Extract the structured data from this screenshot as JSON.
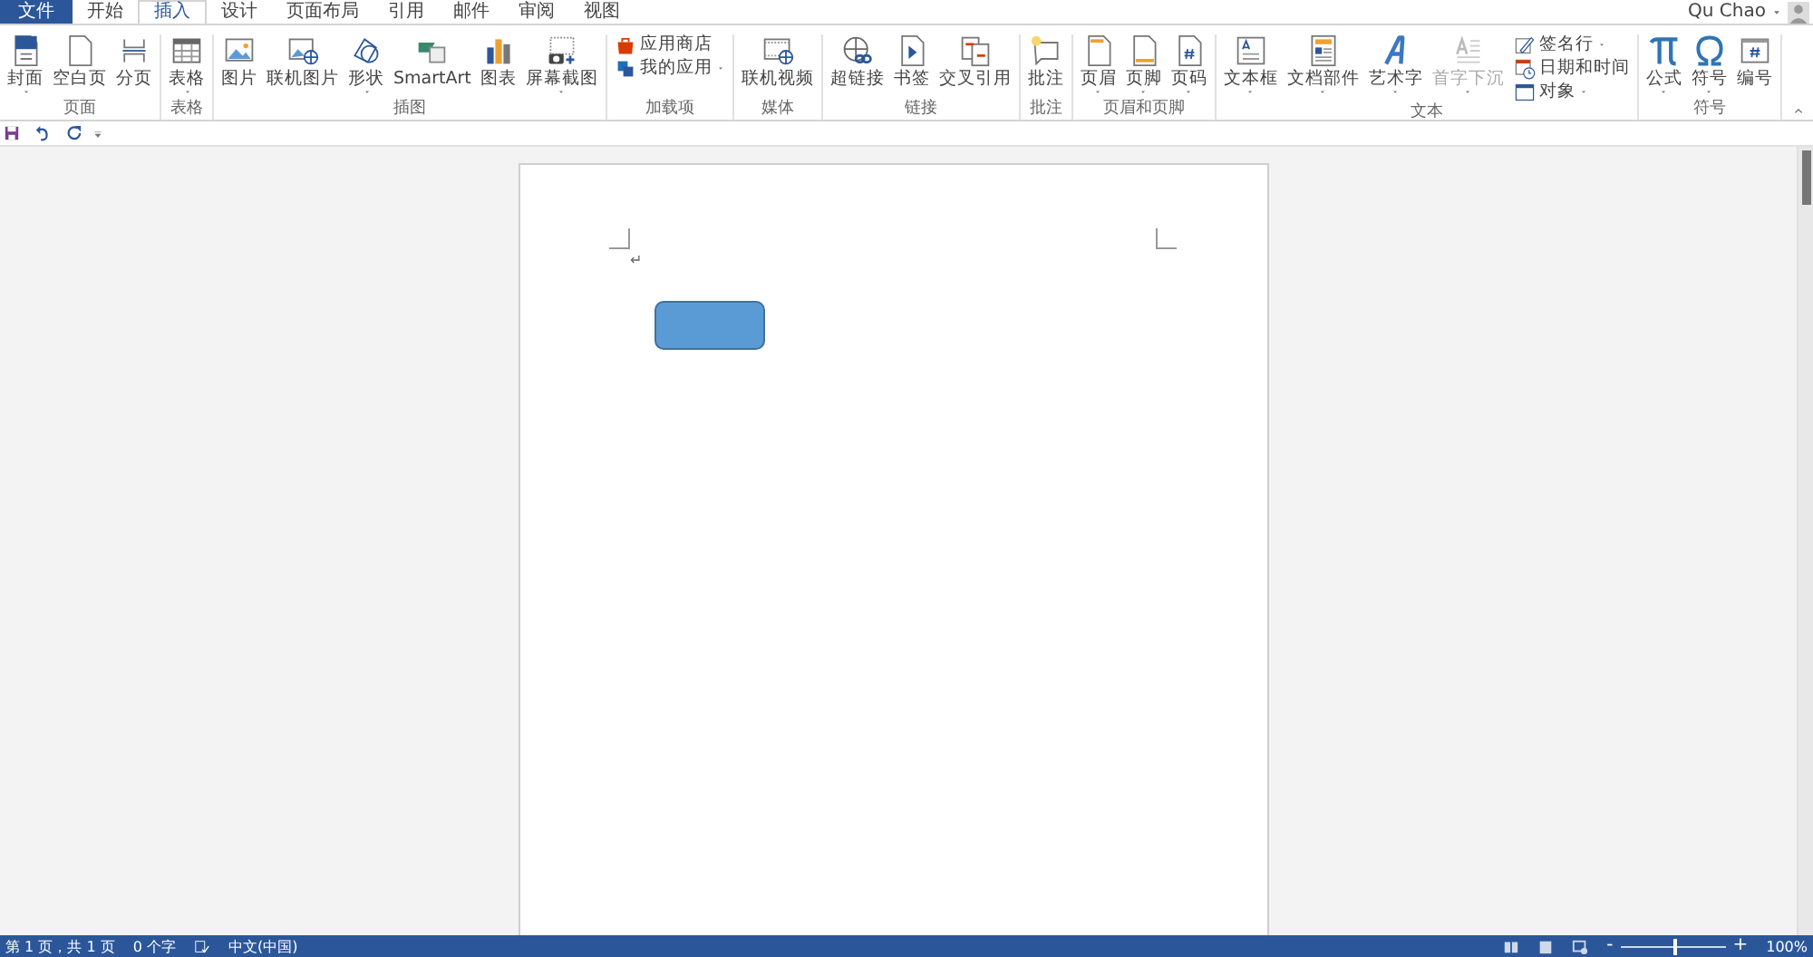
{
  "tabs": [
    {
      "label": "文件",
      "kind": "file",
      "selected": false
    },
    {
      "label": "开始",
      "kind": "tab",
      "selected": false
    },
    {
      "label": "插入",
      "kind": "tab",
      "selected": true
    },
    {
      "label": "设计",
      "kind": "tab",
      "selected": false
    },
    {
      "label": "页面布局",
      "kind": "tab",
      "selected": false
    },
    {
      "label": "引用",
      "kind": "tab",
      "selected": false
    },
    {
      "label": "邮件",
      "kind": "tab",
      "selected": false
    },
    {
      "label": "审阅",
      "kind": "tab",
      "selected": false
    },
    {
      "label": "视图",
      "kind": "tab",
      "selected": false
    }
  ],
  "user": {
    "name": "Qu Chao"
  },
  "ribbon": {
    "groups": [
      {
        "label": "页面",
        "items": [
          {
            "label": "封面",
            "kind": "large",
            "dropdown": true,
            "disabled": false
          },
          {
            "label": "空白页",
            "kind": "large",
            "dropdown": false,
            "disabled": false
          },
          {
            "label": "分页",
            "kind": "large",
            "dropdown": false,
            "disabled": false
          }
        ]
      },
      {
        "label": "表格",
        "items": [
          {
            "label": "表格",
            "kind": "large",
            "dropdown": true,
            "disabled": false
          }
        ]
      },
      {
        "label": "插图",
        "items": [
          {
            "label": "图片",
            "kind": "large",
            "dropdown": false,
            "disabled": false
          },
          {
            "label": "联机图片",
            "kind": "large",
            "dropdown": false,
            "disabled": false
          },
          {
            "label": "形状",
            "kind": "large",
            "dropdown": true,
            "disabled": false
          },
          {
            "label": "SmartArt",
            "kind": "large",
            "dropdown": false,
            "disabled": false
          },
          {
            "label": "图表",
            "kind": "large",
            "dropdown": false,
            "disabled": false
          },
          {
            "label": "屏幕截图",
            "kind": "large",
            "dropdown": true,
            "disabled": false
          }
        ]
      },
      {
        "label": "加载项",
        "items": [
          {
            "label": "应用商店",
            "kind": "small",
            "dropdown": false,
            "disabled": false
          },
          {
            "label": "我的应用",
            "kind": "small",
            "dropdown": true,
            "disabled": false
          }
        ]
      },
      {
        "label": "媒体",
        "items": [
          {
            "label": "联机视频",
            "kind": "large",
            "dropdown": false,
            "disabled": false
          }
        ]
      },
      {
        "label": "链接",
        "items": [
          {
            "label": "超链接",
            "kind": "large",
            "dropdown": false,
            "disabled": false
          },
          {
            "label": "书签",
            "kind": "large",
            "dropdown": false,
            "disabled": false
          },
          {
            "label": "交叉引用",
            "kind": "large",
            "dropdown": false,
            "disabled": false
          }
        ]
      },
      {
        "label": "批注",
        "items": [
          {
            "label": "批注",
            "kind": "large",
            "dropdown": false,
            "disabled": false
          }
        ]
      },
      {
        "label": "页眉和页脚",
        "items": [
          {
            "label": "页眉",
            "kind": "large",
            "dropdown": true,
            "disabled": false
          },
          {
            "label": "页脚",
            "kind": "large",
            "dropdown": true,
            "disabled": false
          },
          {
            "label": "页码",
            "kind": "large",
            "dropdown": true,
            "disabled": false
          }
        ]
      },
      {
        "label": "文本",
        "items": [
          {
            "label": "文本框",
            "kind": "large",
            "dropdown": true,
            "disabled": false
          },
          {
            "label": "文档部件",
            "kind": "large",
            "dropdown": true,
            "disabled": false
          },
          {
            "label": "艺术字",
            "kind": "large",
            "dropdown": true,
            "disabled": false
          },
          {
            "label": "首字下沉",
            "kind": "large",
            "dropdown": true,
            "disabled": true
          },
          {
            "label": "签名行",
            "kind": "small",
            "dropdown": true,
            "disabled": false
          },
          {
            "label": "日期和时间",
            "kind": "small",
            "dropdown": false,
            "disabled": false
          },
          {
            "label": "对象",
            "kind": "small",
            "dropdown": true,
            "disabled": false
          }
        ]
      },
      {
        "label": "符号",
        "items": [
          {
            "label": "公式",
            "kind": "large",
            "dropdown": true,
            "disabled": false
          },
          {
            "label": "符号",
            "kind": "large",
            "dropdown": true,
            "disabled": false
          },
          {
            "label": "编号",
            "kind": "large",
            "dropdown": false,
            "disabled": false
          }
        ]
      }
    ]
  },
  "document": {
    "paragraph_mark": "↵"
  },
  "status_bar": {
    "page": "第 1 页，共 1 页",
    "words": "0 个字",
    "language": "中文(中国)",
    "zoom": "100%",
    "zoom_out": "-",
    "zoom_in": "+",
    "zoom_level": {
      "level": 0.5
    }
  }
}
